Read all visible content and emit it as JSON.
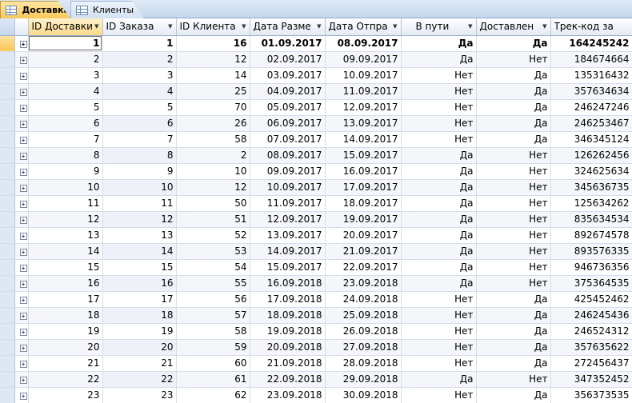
{
  "tabs": [
    {
      "label": "Доставка"
    },
    {
      "label": "Клиенты"
    }
  ],
  "columns": [
    {
      "label": "ID Доставки"
    },
    {
      "label": "ID Заказа"
    },
    {
      "label": "ID Клиента"
    },
    {
      "label": "Дата Разме"
    },
    {
      "label": "Дата Отпра"
    },
    {
      "label": "В пути"
    },
    {
      "label": "Доставлен"
    },
    {
      "label": "Трек-код за"
    }
  ],
  "rows": [
    [
      1,
      1,
      16,
      "01.09.2017",
      "08.09.2017",
      "Да",
      "Да",
      "164245242"
    ],
    [
      2,
      2,
      12,
      "02.09.2017",
      "09.09.2017",
      "Да",
      "Нет",
      "184674664"
    ],
    [
      3,
      3,
      14,
      "03.09.2017",
      "10.09.2017",
      "Нет",
      "Да",
      "135316432"
    ],
    [
      4,
      4,
      25,
      "04.09.2017",
      "11.09.2017",
      "Нет",
      "Да",
      "357634634"
    ],
    [
      5,
      5,
      70,
      "05.09.2017",
      "12.09.2017",
      "Нет",
      "Да",
      "246247246"
    ],
    [
      6,
      6,
      26,
      "06.09.2017",
      "13.09.2017",
      "Нет",
      "Да",
      "246253467"
    ],
    [
      7,
      7,
      58,
      "07.09.2017",
      "14.09.2017",
      "Нет",
      "Да",
      "346345124"
    ],
    [
      8,
      8,
      2,
      "08.09.2017",
      "15.09.2017",
      "Да",
      "Нет",
      "126262456"
    ],
    [
      9,
      9,
      10,
      "09.09.2017",
      "16.09.2017",
      "Да",
      "Нет",
      "324625634"
    ],
    [
      10,
      10,
      12,
      "10.09.2017",
      "17.09.2017",
      "Да",
      "Нет",
      "345636735"
    ],
    [
      11,
      11,
      50,
      "11.09.2017",
      "18.09.2017",
      "Да",
      "Нет",
      "125634262"
    ],
    [
      12,
      12,
      51,
      "12.09.2017",
      "19.09.2017",
      "Да",
      "Нет",
      "835634534"
    ],
    [
      13,
      13,
      52,
      "13.09.2017",
      "20.09.2017",
      "Да",
      "Нет",
      "892674578"
    ],
    [
      14,
      14,
      53,
      "14.09.2017",
      "21.09.2017",
      "Да",
      "Нет",
      "893576335"
    ],
    [
      15,
      15,
      54,
      "15.09.2017",
      "22.09.2017",
      "Да",
      "Нет",
      "946736356"
    ],
    [
      16,
      16,
      55,
      "16.09.2018",
      "23.09.2018",
      "Да",
      "Нет",
      "375364535"
    ],
    [
      17,
      17,
      56,
      "17.09.2018",
      "24.09.2018",
      "Нет",
      "Да",
      "425452462"
    ],
    [
      18,
      18,
      57,
      "18.09.2018",
      "25.09.2018",
      "Нет",
      "Да",
      "246245436"
    ],
    [
      19,
      19,
      58,
      "19.09.2018",
      "26.09.2018",
      "Нет",
      "Да",
      "246524312"
    ],
    [
      20,
      20,
      59,
      "20.09.2018",
      "27.09.2018",
      "Нет",
      "Да",
      "357635622"
    ],
    [
      21,
      21,
      60,
      "21.09.2018",
      "28.09.2018",
      "Нет",
      "Да",
      "272456437"
    ],
    [
      22,
      22,
      61,
      "22.09.2018",
      "29.09.2018",
      "Да",
      "Нет",
      "347352452"
    ],
    [
      23,
      23,
      62,
      "23.09.2018",
      "30.09.2018",
      "Нет",
      "Да",
      "356373535"
    ]
  ],
  "expand_glyph": "+",
  "dropdown_glyph": "▼"
}
